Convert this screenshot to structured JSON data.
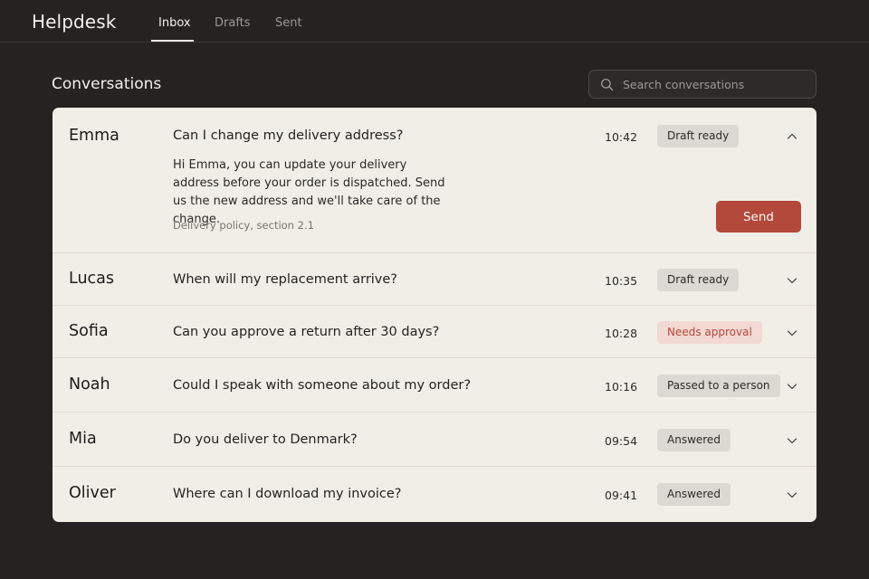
{
  "app": {
    "title": "Helpdesk"
  },
  "nav": {
    "tabs": [
      {
        "label": "Inbox"
      },
      {
        "label": "Drafts"
      },
      {
        "label": "Sent"
      }
    ]
  },
  "main": {
    "title": "Conversations",
    "search": {
      "placeholder": "Search conversations",
      "value": ""
    }
  },
  "conversations": [
    {
      "name": "Emma",
      "subject": "Can I change my delivery address?",
      "time": "10:42",
      "status": "Draft ready",
      "expanded": true,
      "reply": "Hi Emma, you can update your delivery address before your order is dispatched. Send us the new address and we'll take care of the change.",
      "source": "Delivery policy, section 2.1",
      "send_label": "Send"
    },
    {
      "name": "Lucas",
      "subject": "When will my replacement arrive?",
      "time": "10:35",
      "status": "Draft ready"
    },
    {
      "name": "Sofia",
      "subject": "Can you approve a return after 30 days?",
      "time": "10:28",
      "status": "Needs approval"
    },
    {
      "name": "Noah",
      "subject": "Could I speak with someone about my order?",
      "time": "10:16",
      "status": "Passed to a person"
    },
    {
      "name": "Mia",
      "subject": "Do you deliver to Denmark?",
      "time": "09:54",
      "status": "Answered"
    },
    {
      "name": "Oliver",
      "subject": "Where can I download my invoice?",
      "time": "09:41",
      "status": "Answered"
    }
  ],
  "icons": {
    "search": "search-icon",
    "expand": "chevron-down-icon",
    "collapse": "chevron-up-icon"
  },
  "colors": {
    "accent": "#b2493b",
    "warning_text": "#b6483c",
    "warning_bg": "#f2d9d3",
    "neutral_badge": "#dcd9d2"
  }
}
